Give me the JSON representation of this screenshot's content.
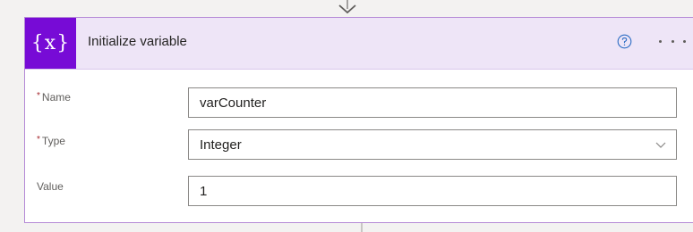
{
  "action": {
    "icon_text": "{x}",
    "icon_name": "variable-icon",
    "title": "Initialize variable",
    "help_icon": "help-circle-icon",
    "more_icon": "more-ellipsis-icon"
  },
  "fields": {
    "name": {
      "label": "Name",
      "required": true,
      "value": "varCounter"
    },
    "type": {
      "label": "Type",
      "required": true,
      "value": "Integer"
    },
    "value": {
      "label": "Value",
      "required": false,
      "value": "1"
    }
  },
  "required_marker": "*",
  "colors": {
    "accent": "#770bd6",
    "header_bg": "#eee5f7",
    "border": "#b58ad6",
    "required": "#a4262c"
  }
}
